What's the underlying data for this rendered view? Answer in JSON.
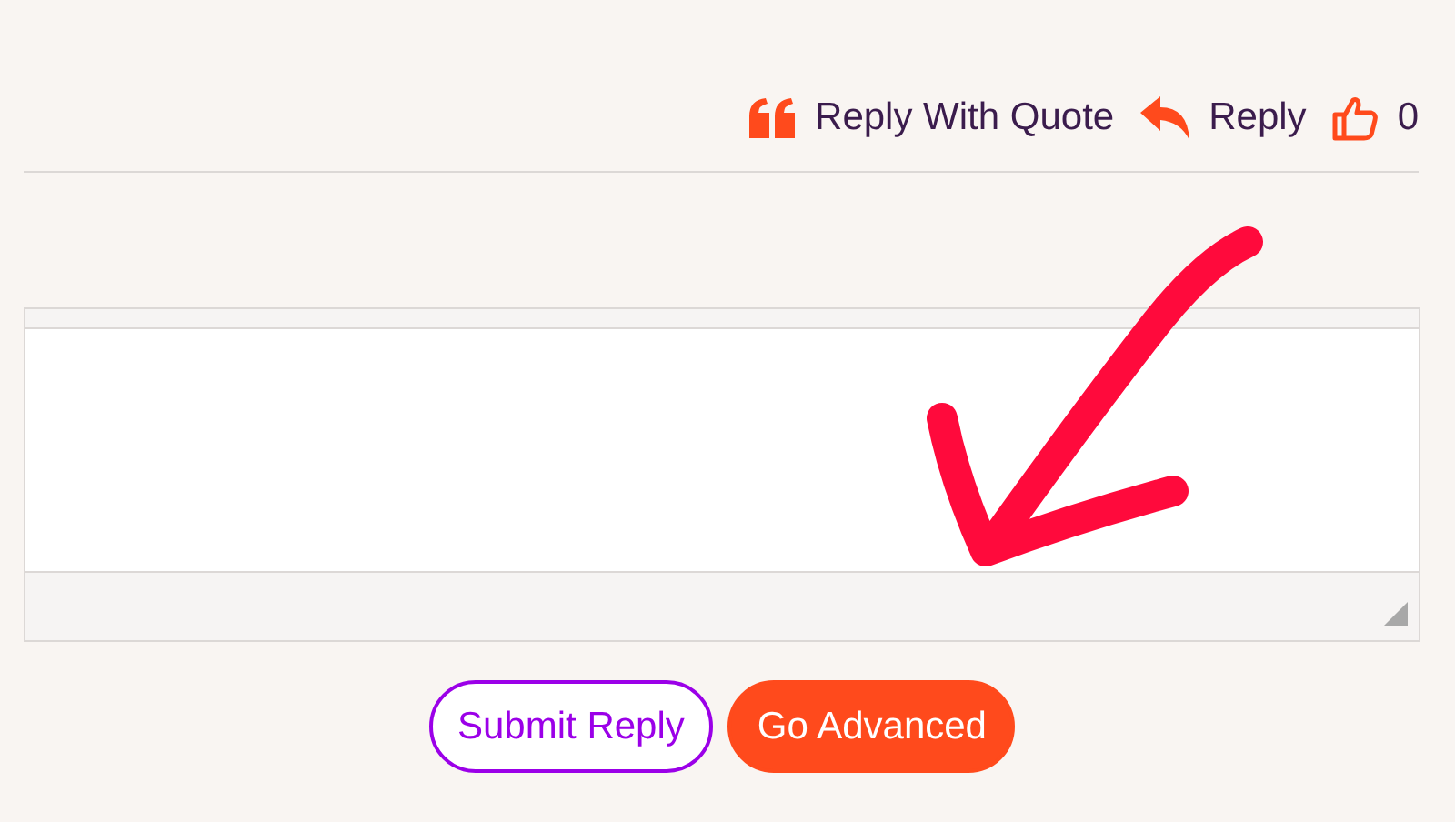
{
  "post_actions": [
    {
      "kind": "quote",
      "label": "Reply With Quote"
    },
    {
      "kind": "reply",
      "label": "Reply"
    },
    {
      "kind": "like",
      "label": "0"
    }
  ],
  "annotation": {
    "kind": "arrow"
  },
  "buttons": [
    {
      "kind": "outline",
      "label": "Submit Reply"
    },
    {
      "kind": "filled",
      "label": "Go Advanced"
    }
  ]
}
